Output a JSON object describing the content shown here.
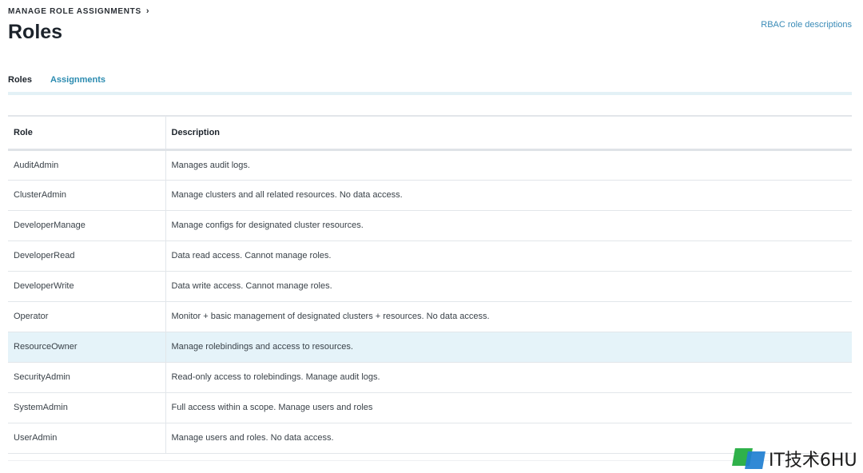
{
  "breadcrumb": {
    "label": "MANAGE ROLE ASSIGNMENTS",
    "chevron": "›"
  },
  "page": {
    "title": "Roles"
  },
  "links": {
    "rbac": "RBAC role descriptions"
  },
  "tabs": [
    {
      "label": "Roles",
      "active": true
    },
    {
      "label": "Assignments",
      "active": false
    }
  ],
  "table": {
    "headers": [
      "Role",
      "Description"
    ],
    "rows": [
      {
        "role": "AuditAdmin",
        "description": "Manages audit logs."
      },
      {
        "role": "ClusterAdmin",
        "description": "Manage clusters and all related resources. No data access."
      },
      {
        "role": "DeveloperManage",
        "description": "Manage configs for designated cluster resources."
      },
      {
        "role": "DeveloperRead",
        "description": "Data read access. Cannot manage roles."
      },
      {
        "role": "DeveloperWrite",
        "description": "Data write access. Cannot manage roles."
      },
      {
        "role": "Operator",
        "description": "Monitor + basic management of designated clusters + resources. No data access."
      },
      {
        "role": "ResourceOwner",
        "description": "Manage rolebindings and access to resources.",
        "highlighted": true
      },
      {
        "role": "SecurityAdmin",
        "description": "Read-only access to rolebindings. Manage audit logs."
      },
      {
        "role": "SystemAdmin",
        "description": "Full access within a scope. Manage users and roles"
      },
      {
        "role": "UserAdmin",
        "description": "Manage users and roles. No data access."
      }
    ]
  },
  "watermark": {
    "text": "IT技术6HU"
  },
  "colors": {
    "accent": "#1d6f9a",
    "link": "#3a8bb7",
    "highlight_row": "#e5f3f9"
  }
}
